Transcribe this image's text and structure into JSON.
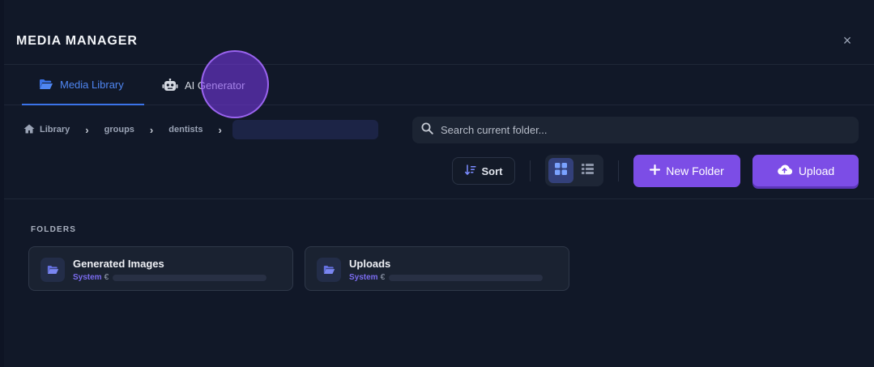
{
  "modal": {
    "title": "MEDIA MANAGER",
    "close_icon": "×"
  },
  "tabs": [
    {
      "label": "Media Library",
      "icon": "folder-open-icon",
      "active": true
    },
    {
      "label": "AI Generator",
      "icon": "robot-icon",
      "active": false
    }
  ],
  "breadcrumb": {
    "items": [
      {
        "label": "Library",
        "icon": "home-icon"
      },
      {
        "label": "groups"
      },
      {
        "label": "dentists"
      }
    ],
    "separator": "›"
  },
  "search": {
    "placeholder": "Search current folder...",
    "value": ""
  },
  "toolbar": {
    "sort_label": "Sort",
    "view_mode": "grid",
    "new_folder_label": "New Folder",
    "upload_label": "Upload"
  },
  "folders_section": {
    "label": "FOLDERS",
    "items": [
      {
        "name": "Generated Images",
        "badge": "System",
        "meta_fragment": "€"
      },
      {
        "name": "Uploads",
        "badge": "System",
        "meta_fragment": "€"
      }
    ]
  },
  "colors": {
    "accent": "#7c4de6",
    "tab_active": "#4f86f2",
    "badge": "#7b6cf0",
    "background": "#111828"
  }
}
